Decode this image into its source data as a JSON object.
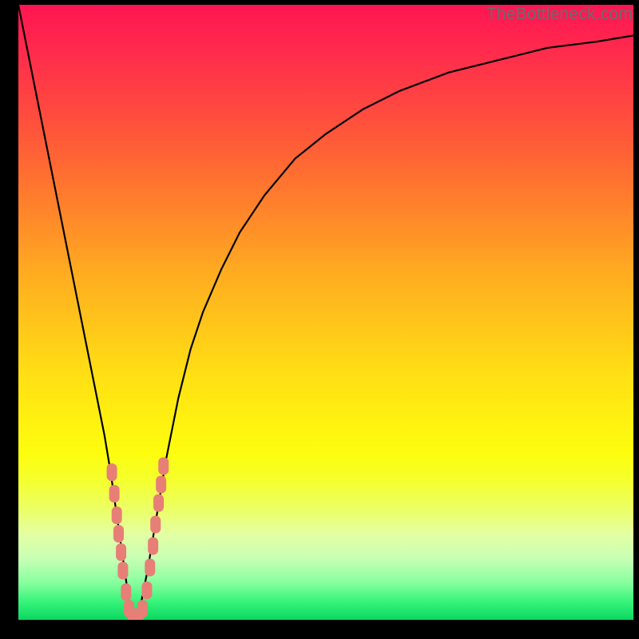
{
  "watermark": "TheBottleneck.com",
  "chart_data": {
    "type": "line",
    "title": "",
    "xlabel": "",
    "ylabel": "",
    "xlim": [
      0,
      100
    ],
    "ylim": [
      0,
      100
    ],
    "grid": false,
    "legend": false,
    "background_gradient": {
      "top_color": "#ff1552",
      "mid_color": "#fff210",
      "bottom_color": "#0bd761"
    },
    "series": [
      {
        "name": "bottleneck_curve",
        "color": "#000000",
        "x": [
          0,
          2,
          4,
          6,
          8,
          10,
          12,
          14,
          15,
          16,
          17,
          18,
          18.5,
          19,
          20,
          21,
          22,
          23,
          24,
          26,
          28,
          30,
          33,
          36,
          40,
          45,
          50,
          56,
          62,
          70,
          78,
          86,
          94,
          100
        ],
        "y": [
          100,
          90,
          80,
          70,
          60,
          50,
          40,
          30,
          24,
          17,
          10,
          3,
          0,
          0,
          3,
          8,
          14,
          20,
          26,
          36,
          44,
          50,
          57,
          63,
          69,
          75,
          79,
          83,
          86,
          89,
          91,
          93,
          94,
          95
        ]
      }
    ],
    "markers": [
      {
        "name": "cluster_points",
        "color": "#e77f77",
        "shape": "rounded-rect",
        "points": [
          {
            "x": 15.2,
            "y": 24.0
          },
          {
            "x": 15.6,
            "y": 20.5
          },
          {
            "x": 16.0,
            "y": 17.0
          },
          {
            "x": 16.3,
            "y": 14.0
          },
          {
            "x": 16.7,
            "y": 11.0
          },
          {
            "x": 17.0,
            "y": 8.0
          },
          {
            "x": 17.5,
            "y": 4.5
          },
          {
            "x": 18.0,
            "y": 1.8
          },
          {
            "x": 18.6,
            "y": 0.5
          },
          {
            "x": 19.5,
            "y": 0.5
          },
          {
            "x": 20.2,
            "y": 1.8
          },
          {
            "x": 20.9,
            "y": 4.8
          },
          {
            "x": 21.4,
            "y": 8.5
          },
          {
            "x": 21.9,
            "y": 12.0
          },
          {
            "x": 22.3,
            "y": 15.5
          },
          {
            "x": 22.8,
            "y": 19.0
          },
          {
            "x": 23.2,
            "y": 22.0
          },
          {
            "x": 23.6,
            "y": 25.0
          }
        ]
      }
    ]
  }
}
